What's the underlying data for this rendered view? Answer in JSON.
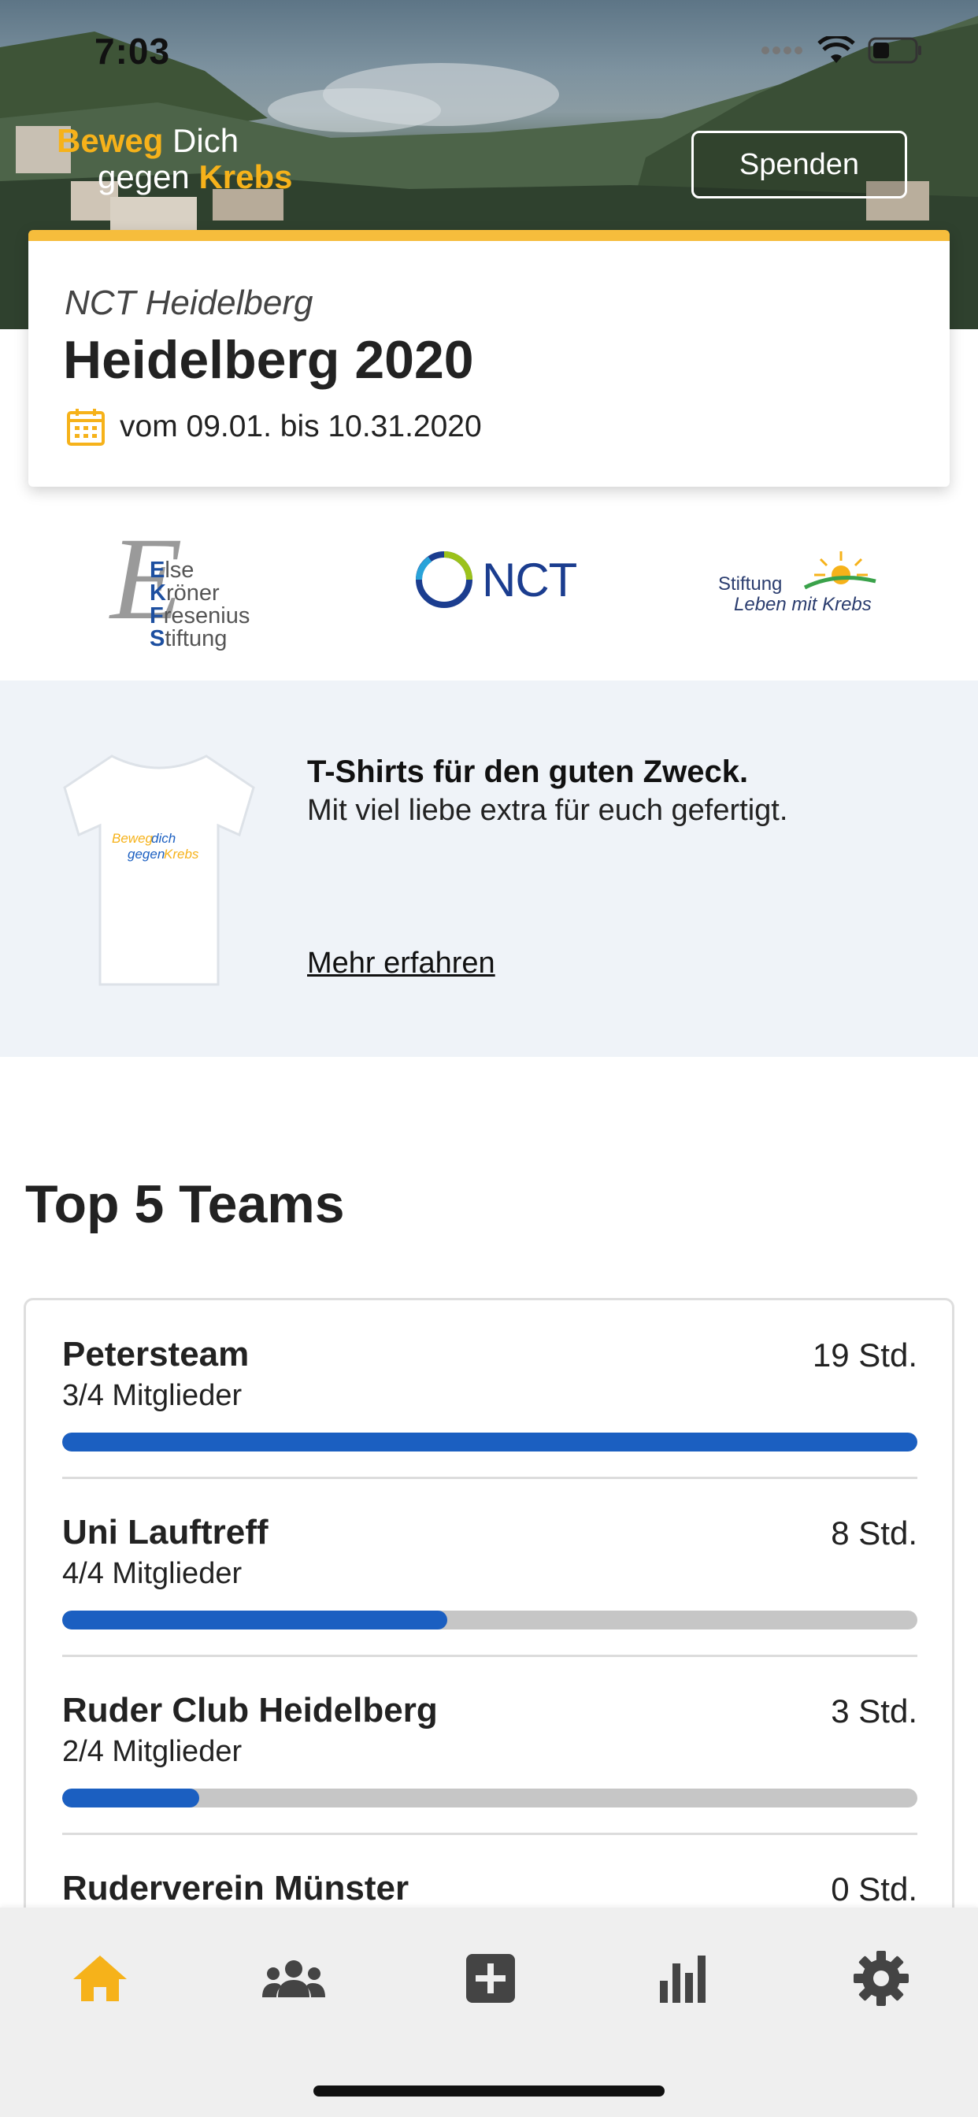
{
  "status_bar": {
    "time": "7:03"
  },
  "header": {
    "logo_line1_a": "Beweg",
    "logo_line1_b": "Dich",
    "logo_line2_a": "gegen",
    "logo_line2_b": "Krebs",
    "donate_label": "Spenden"
  },
  "event": {
    "organizer": "NCT Heidelberg",
    "title": "Heidelberg 2020",
    "date_range": "vom 09.01. bis 10.31.2020",
    "accent_color": "#f6bd3c"
  },
  "sponsors": {
    "ekfs_lines": [
      "Else",
      "Kröner",
      "Fresenius",
      "Stiftung"
    ],
    "ekfs_initials": [
      "E",
      "K",
      "F",
      "S"
    ],
    "ekfs_rest": [
      "lse",
      "röner",
      "resenius",
      "tiftung"
    ],
    "nct_label": "NCT",
    "slmk_line1": "Stiftung",
    "slmk_line2": "Leben mit Krebs"
  },
  "promo": {
    "heading": "T-Shirts für den guten Zweck.",
    "subtext": "Mit viel liebe extra für euch gefertigt.",
    "link": "Mehr erfahren",
    "shirt_print_line1_a": "Beweg",
    "shirt_print_line1_b": "dich",
    "shirt_print_line2_a": "gegen",
    "shirt_print_line2_b": "Krebs"
  },
  "teams": {
    "title": "Top 5 Teams",
    "bar_color": "#1b5fc1",
    "items": [
      {
        "name": "Petersteam",
        "members": "3/4 Mitglieder",
        "hours": "19 Std.",
        "progress": 1.0
      },
      {
        "name": "Uni Lauftreff",
        "members": "4/4 Mitglieder",
        "hours": "8 Std.",
        "progress": 0.45
      },
      {
        "name": "Ruder Club Heidelberg",
        "members": "2/4 Mitglieder",
        "hours": "3 Std.",
        "progress": 0.16
      },
      {
        "name": "Ruderverein Münster",
        "members": "",
        "hours": "0 Std.",
        "progress": 0.0
      }
    ]
  },
  "tabbar": {
    "active_color": "#f6b21a",
    "inactive_color": "#444444",
    "icons": [
      "home-icon",
      "team-icon",
      "add-icon",
      "stats-icon",
      "settings-icon"
    ]
  }
}
